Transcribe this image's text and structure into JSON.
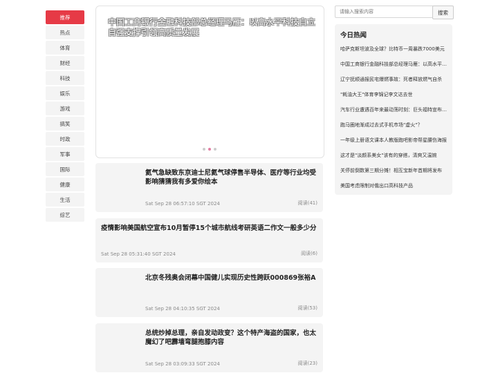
{
  "nav": {
    "items": [
      "推荐",
      "热点",
      "体育",
      "财经",
      "科技",
      "娱乐",
      "游戏",
      "搞笑",
      "时政",
      "军事",
      "国际",
      "健康",
      "生活",
      "综艺"
    ],
    "active_index": 0
  },
  "banner": {
    "title": "中国工商银行金融科技部总经理马雁：以高水平科技自立自强支撑引领高质量发展",
    "dot_count": 3,
    "active_dot": 1
  },
  "articles": [
    {
      "title": "氦气急缺致东京迪士尼氦气球停售半导体、医疗等行业均受影响猜猜我有多爱你绘本",
      "time": "Sat Sep 28 06:57:10 SGT 2024",
      "reads": "阅读(41)",
      "has_thumb": true
    },
    {
      "title": "疫情影响美国航空宣布10月暂停15个城市航线考研英语二作文一般多少分",
      "time": "Sat Sep 28 05:31:40 SGT 2024",
      "reads": "阅读(6)",
      "has_thumb": false
    },
    {
      "title": "北京冬残奥会闭幕中国健儿实现历史性跨跃000869张裕A",
      "time": "Sat Sep 28 04:10:35 SGT 2024",
      "reads": "阅读(53)",
      "has_thumb": true
    },
    {
      "title": "总统炒掉总理，亲自发动政变？这个特产海盗的国家，也太魔幻了吧霹墙弯腿抱膝内容",
      "time": "Sat Sep 28 03:09:33 SGT 2024",
      "reads": "阅读(23)",
      "has_thumb": true
    }
  ],
  "search": {
    "placeholder": "请输入搜索内容",
    "button_label": "搜索"
  },
  "hot": {
    "title": "今日热闻",
    "items": [
      "哈萨克斯坦波及全球？比特币一周暴跌7000美元",
      "中国工商银行金融科技部总经理马雁：以高水平科技自立自强",
      "辽宁抚顺通报民宅爆燃事故：死者释放燃气自杀",
      "\"耗油大王\"体育李锦记李文达去世",
      "汽车行业遭遇百年来最动荡时刻：巨头福特宣布裁员",
      "跑马圈地渐成过去式手机市场\"虚火\"？",
      "一年级上册语文课本人教版跑吧影帝帮星腰伤海报",
      "这才是\"淡颜系美女\"该有的穿搭，清爽又温婉",
      "关停前倒数第三期分摊！相互宝新年首期将发布",
      "美国考虑限制对俄出口高科技产品"
    ]
  },
  "colors": {
    "accent": "#e63a46",
    "card_bg": "#f4f4f4",
    "dot_active": "#e37da3"
  }
}
